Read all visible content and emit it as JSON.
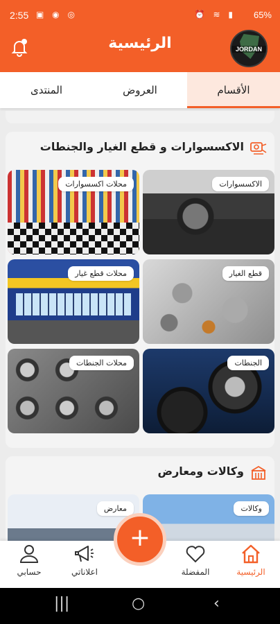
{
  "status_bar": {
    "time": "2:55",
    "battery": "65%",
    "left_icons": "▣ ◉ ◎",
    "right_icons": "⏰ ≋ ▮"
  },
  "header": {
    "title": "الرئيسية",
    "logo_text": "JORDAN"
  },
  "tabs": [
    {
      "label": "الأقسام",
      "active": true
    },
    {
      "label": "العروض",
      "active": false
    },
    {
      "label": "المنتدى",
      "active": false
    }
  ],
  "sections": [
    {
      "title": "الاكسسوارات و قطع الغيار والجنطات",
      "icon": "car-parts-icon",
      "tiles": [
        {
          "label": "الاكسسوارات",
          "image": "car-interior"
        },
        {
          "label": "محلات اكسسوارات",
          "image": "accessories-store"
        },
        {
          "label": "قطع الغيار",
          "image": "spare-parts"
        },
        {
          "label": "محلات قطع غيار",
          "image": "parts-shopfront"
        },
        {
          "label": "الجنطات",
          "image": "tires"
        },
        {
          "label": "محلات الجنطات",
          "image": "rims-store"
        }
      ]
    },
    {
      "title": "وكالات ومعارض",
      "icon": "showroom-icon",
      "tiles": [
        {
          "label": "وكالات",
          "image": "dealership"
        },
        {
          "label": "معارض",
          "image": "showroom"
        }
      ]
    }
  ],
  "bottom_nav": [
    {
      "label": "الرئيسية",
      "icon": "home-icon",
      "active": true
    },
    {
      "label": "المفضلة",
      "icon": "heart-icon",
      "active": false
    },
    {
      "label": "اعلاناتي",
      "icon": "megaphone-icon",
      "active": false
    },
    {
      "label": "حسابي",
      "icon": "user-icon",
      "active": false
    }
  ],
  "fab": {
    "symbol": "+"
  },
  "system_nav": {
    "recent": "|||",
    "home": "○",
    "back": "‹"
  },
  "colors": {
    "accent": "#f35f28",
    "accent_light": "#fde8de",
    "background": "#ececec"
  }
}
